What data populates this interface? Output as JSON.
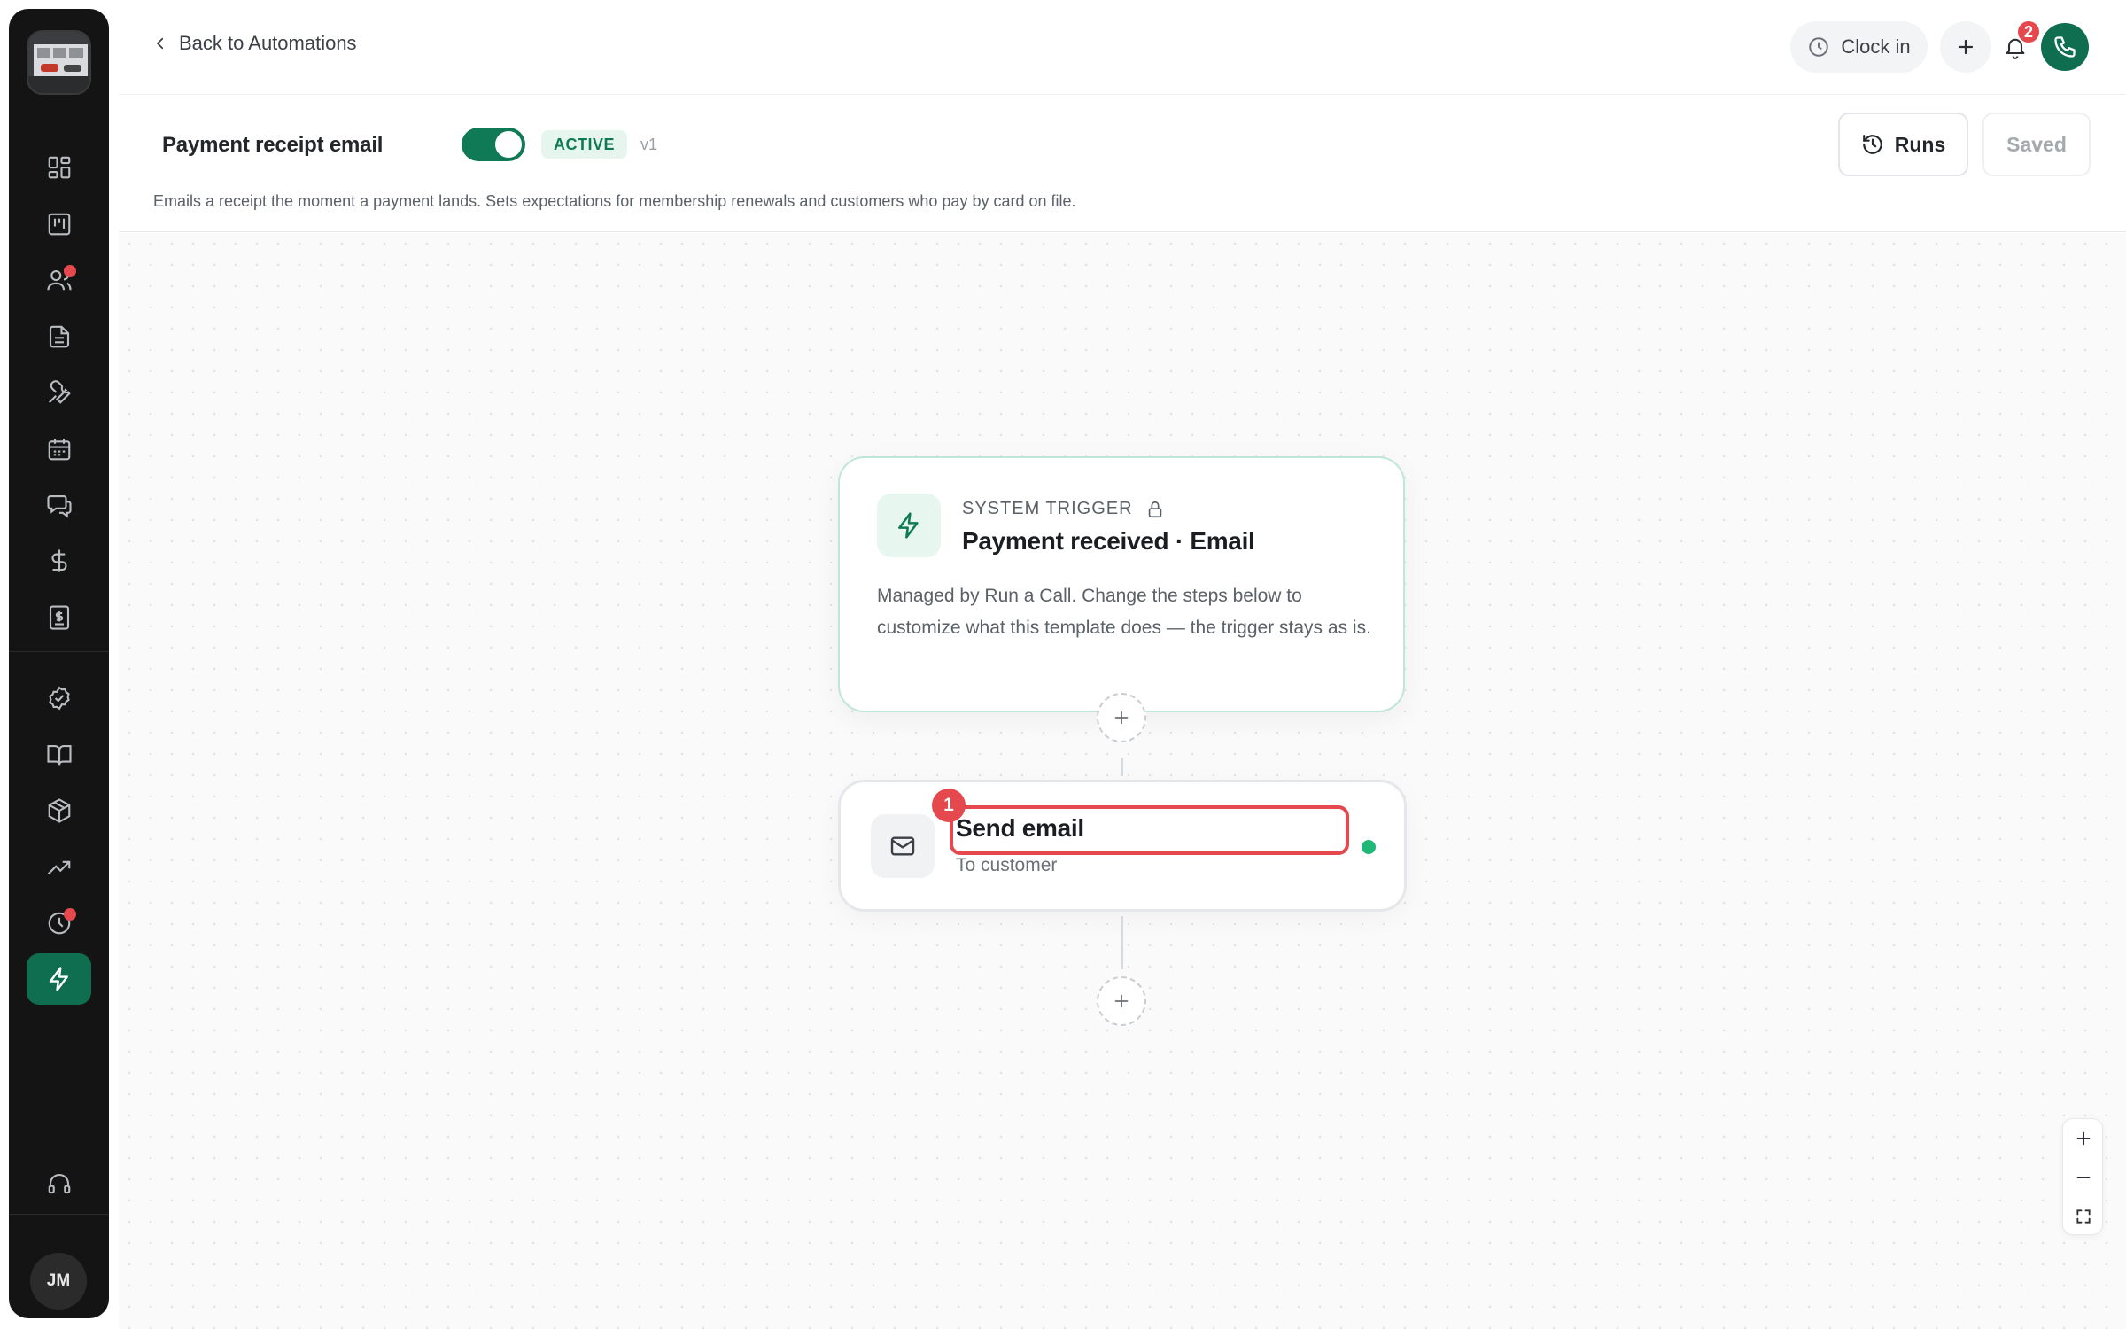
{
  "sidebar": {
    "logo_alt": "company-logo",
    "items": [
      {
        "icon": "dashboard-icon",
        "active": false,
        "dot": false
      },
      {
        "icon": "board-icon",
        "active": false,
        "dot": false
      },
      {
        "icon": "customers-icon",
        "active": false,
        "dot": true
      },
      {
        "icon": "document-icon",
        "active": false,
        "dot": false
      },
      {
        "icon": "wrench-icon",
        "active": false,
        "dot": false
      },
      {
        "icon": "calendar-icon",
        "active": false,
        "dot": false
      },
      {
        "icon": "chat-icon",
        "active": false,
        "dot": false
      },
      {
        "icon": "dollar-icon",
        "active": false,
        "dot": false
      },
      {
        "icon": "invoice-icon",
        "active": false,
        "dot": false
      },
      {
        "icon": "check-circle-icon",
        "active": false,
        "dot": false
      },
      {
        "icon": "book-icon",
        "active": false,
        "dot": false
      },
      {
        "icon": "package-icon",
        "active": false,
        "dot": false
      },
      {
        "icon": "trending-up-icon",
        "active": false,
        "dot": false
      },
      {
        "icon": "clock-icon",
        "active": false,
        "dot": true
      },
      {
        "icon": "lightning-icon",
        "active": true,
        "dot": false
      }
    ],
    "support_icon": "headset-icon",
    "avatar_initials": "JM"
  },
  "topbar": {
    "back_label": "Back to Automations",
    "clock_in_label": "Clock in",
    "notification_count": "2"
  },
  "header": {
    "name": "Payment receipt email",
    "toggle_on": true,
    "status": "ACTIVE",
    "version": "v1",
    "description": "Emails a receipt the moment a payment lands. Sets expectations for membership renewals and customers who pay by card on file.",
    "runs_label": "Runs",
    "saved_label": "Saved"
  },
  "trigger": {
    "label": "SYSTEM TRIGGER",
    "title": "Payment received · Email",
    "body": "Managed by Run a Call. Change the steps below to customize what this template does — the trigger stays as is."
  },
  "step": {
    "number": "1",
    "title": "Send email",
    "subtitle": "To customer",
    "status_color": "#1fb877"
  },
  "colors": {
    "accent": "#0f6e4f",
    "danger": "#e5484d",
    "active_badge_bg": "#e6f6ee"
  }
}
